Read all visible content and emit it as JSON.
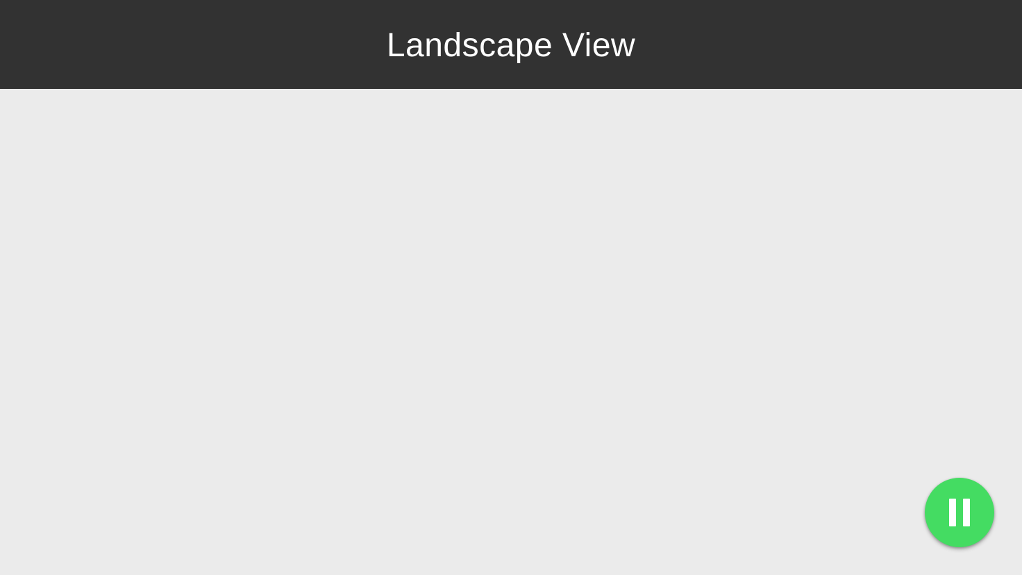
{
  "app_bar": {
    "title": "Landscape View"
  },
  "fab": {
    "icon": "pause-icon",
    "color": "#44dc62"
  },
  "colors": {
    "app_bar_background": "#323232",
    "content_background": "#ebebeb"
  }
}
